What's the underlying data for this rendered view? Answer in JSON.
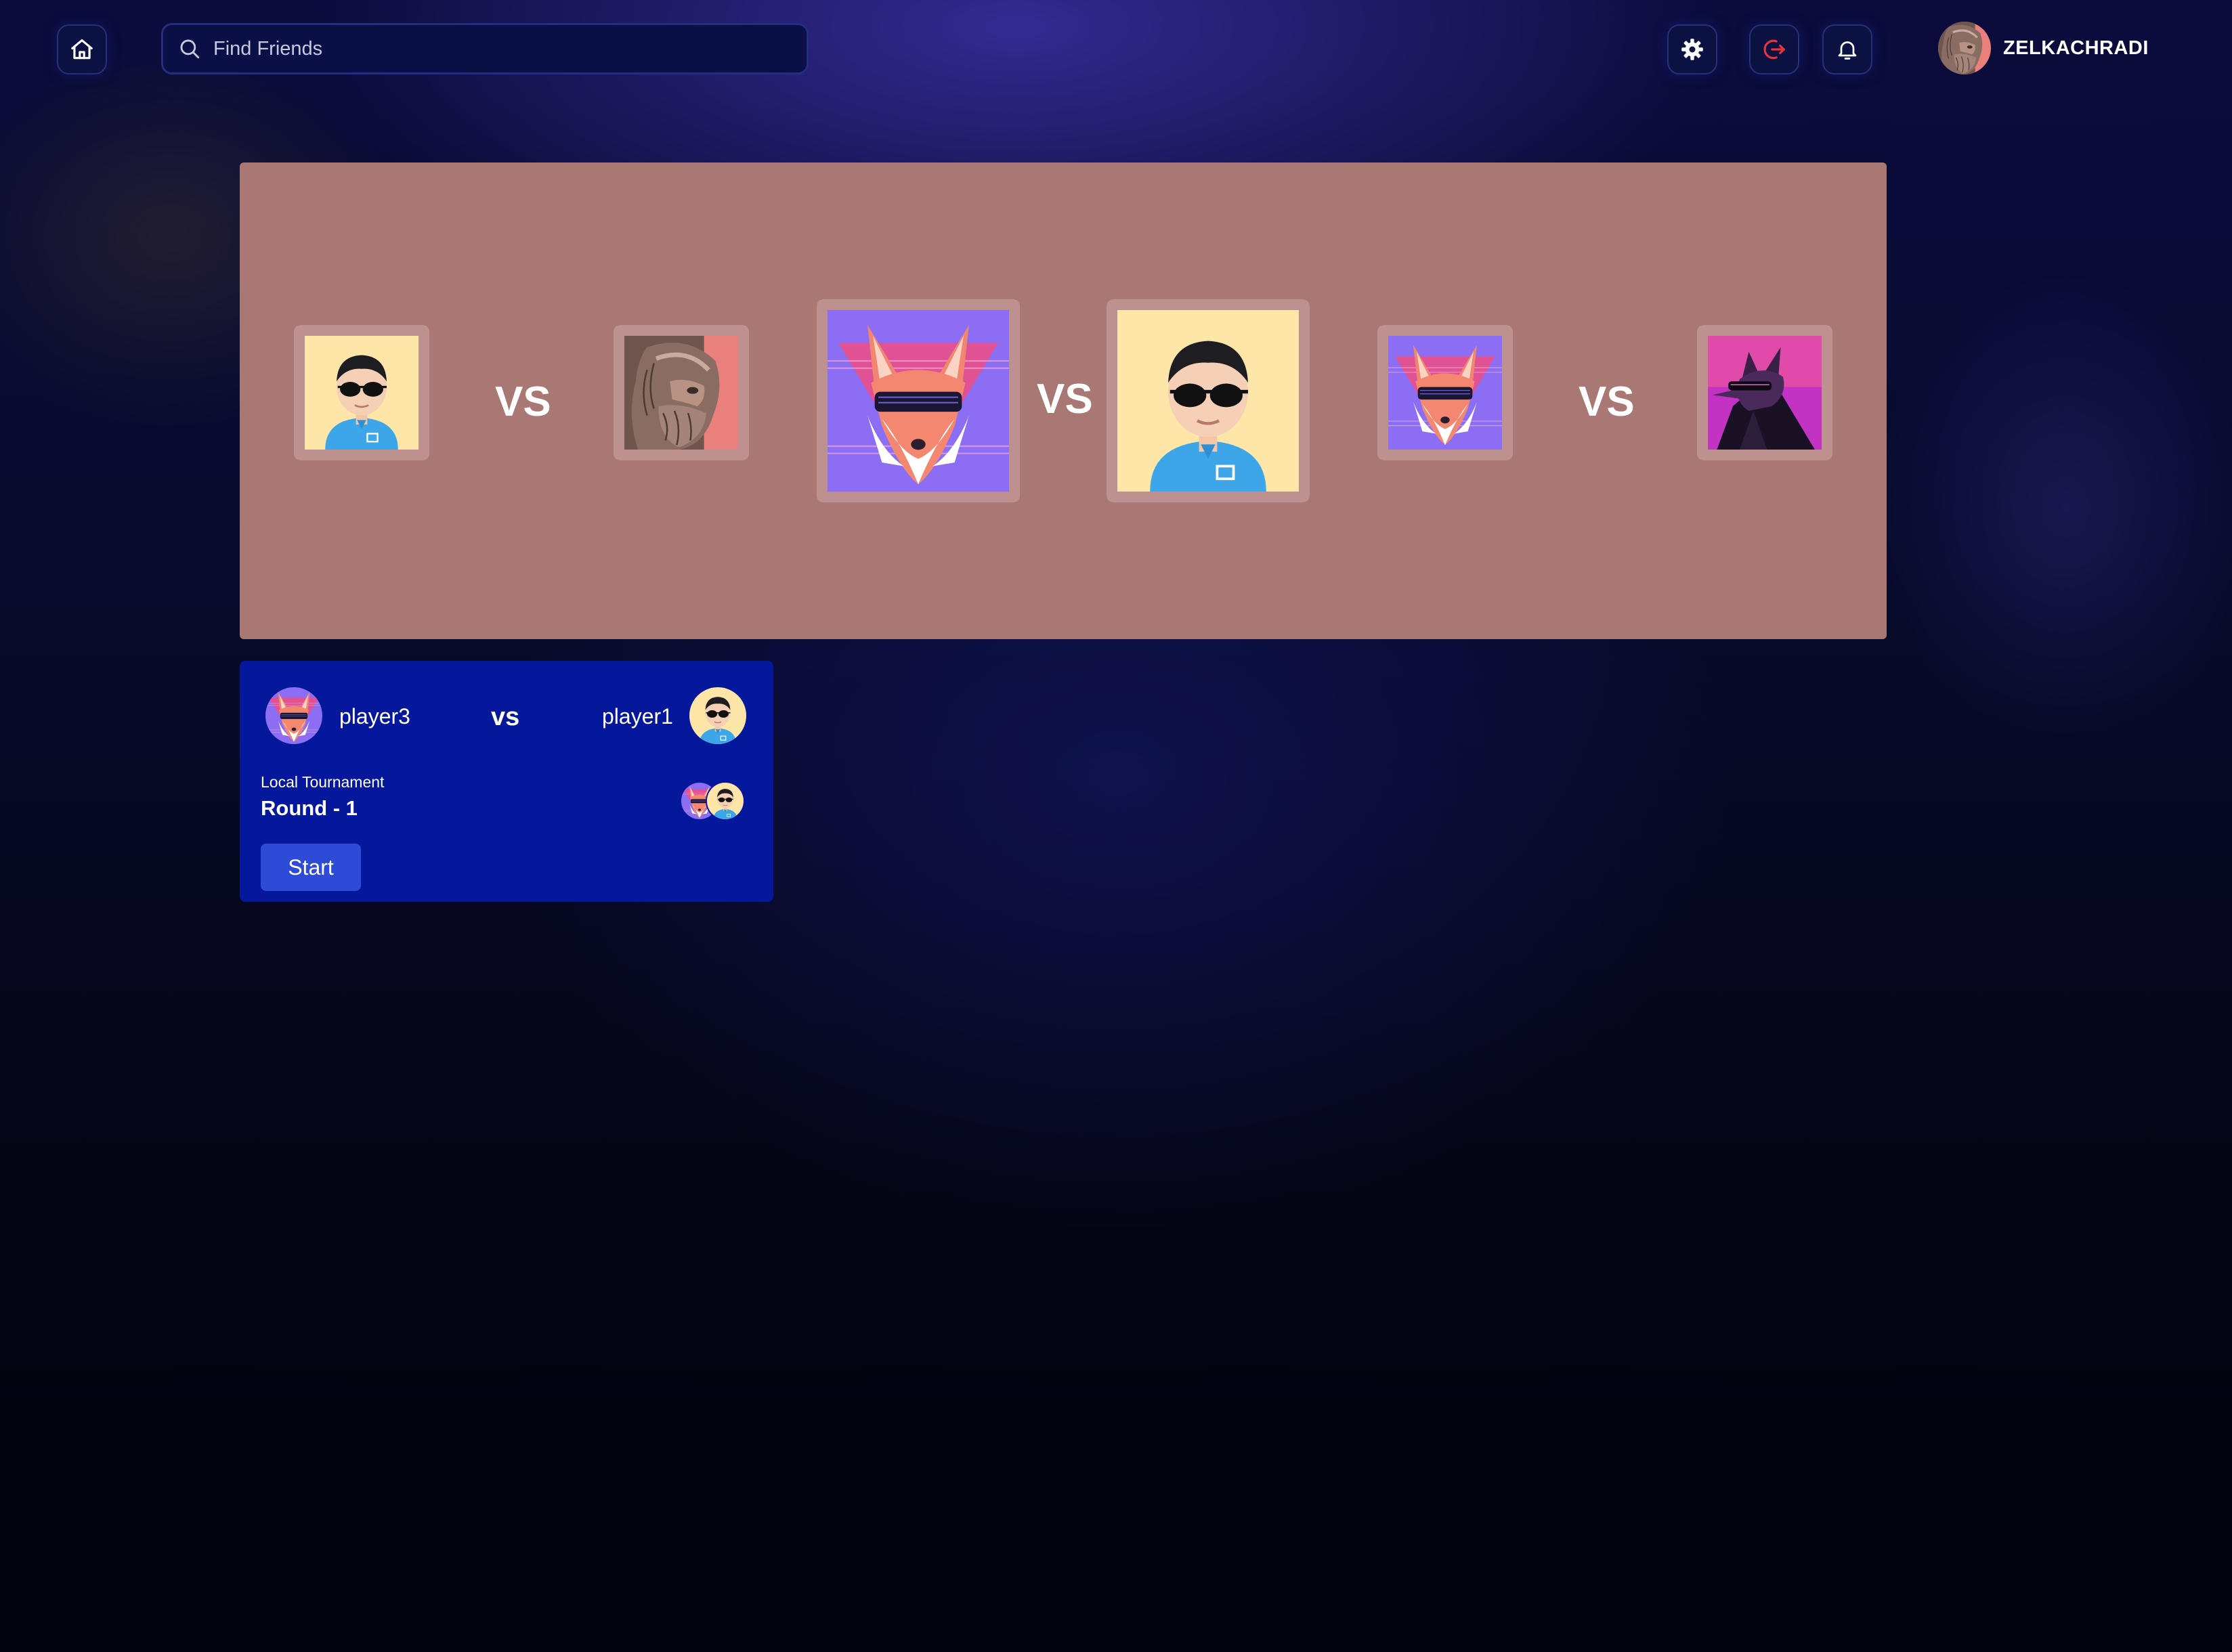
{
  "header": {
    "search_placeholder": "Find Friends",
    "username": "ZELKACHRADI",
    "icons": [
      "home-icon",
      "search-icon",
      "settings-gear-icon",
      "logout-icon",
      "notification-bell-icon",
      "user-avatar"
    ]
  },
  "bracket": {
    "vs_labels": [
      "VS",
      "VS",
      "VS"
    ],
    "players": [
      "sunglasses-man-avatar",
      "zeus-statue-avatar",
      "fox-sunglasses-avatar",
      "sunglasses-man-avatar",
      "fox-sunglasses-avatar",
      "wolf-neon-avatar"
    ]
  },
  "match": {
    "player_left": "player3",
    "player_right": "player1",
    "vs_label": "vs",
    "tournament_label": "Local Tournament",
    "round_label": "Round - 1",
    "start_label": "Start"
  },
  "colors": {
    "bracket_background": "#a97774",
    "card_background": "#05179a",
    "start_button": "#2d4bd6",
    "logout_accent": "#e8323c"
  }
}
